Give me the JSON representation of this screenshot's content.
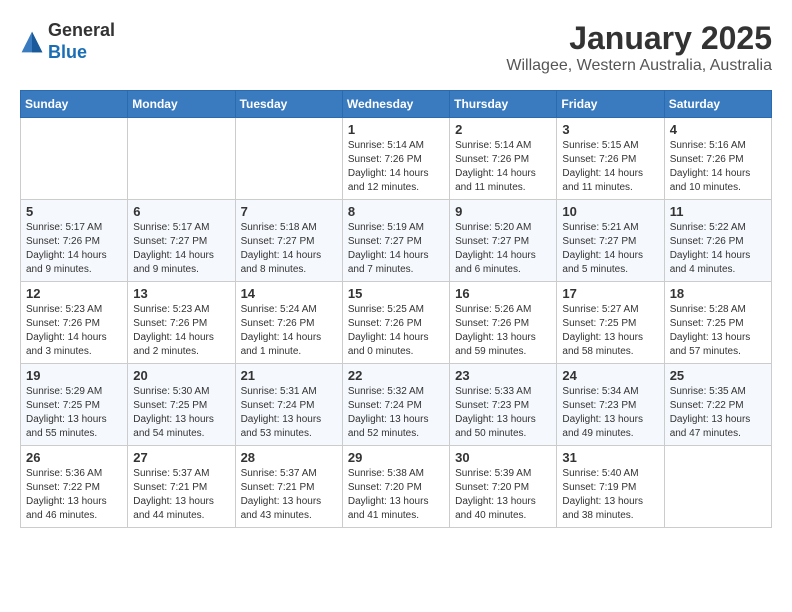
{
  "header": {
    "logo_general": "General",
    "logo_blue": "Blue",
    "title": "January 2025",
    "subtitle": "Willagee, Western Australia, Australia"
  },
  "weekdays": [
    "Sunday",
    "Monday",
    "Tuesday",
    "Wednesday",
    "Thursday",
    "Friday",
    "Saturday"
  ],
  "weeks": [
    [
      {
        "day": "",
        "info": ""
      },
      {
        "day": "",
        "info": ""
      },
      {
        "day": "",
        "info": ""
      },
      {
        "day": "1",
        "info": "Sunrise: 5:14 AM\nSunset: 7:26 PM\nDaylight: 14 hours and 12 minutes."
      },
      {
        "day": "2",
        "info": "Sunrise: 5:14 AM\nSunset: 7:26 PM\nDaylight: 14 hours and 11 minutes."
      },
      {
        "day": "3",
        "info": "Sunrise: 5:15 AM\nSunset: 7:26 PM\nDaylight: 14 hours and 11 minutes."
      },
      {
        "day": "4",
        "info": "Sunrise: 5:16 AM\nSunset: 7:26 PM\nDaylight: 14 hours and 10 minutes."
      }
    ],
    [
      {
        "day": "5",
        "info": "Sunrise: 5:17 AM\nSunset: 7:26 PM\nDaylight: 14 hours and 9 minutes."
      },
      {
        "day": "6",
        "info": "Sunrise: 5:17 AM\nSunset: 7:27 PM\nDaylight: 14 hours and 9 minutes."
      },
      {
        "day": "7",
        "info": "Sunrise: 5:18 AM\nSunset: 7:27 PM\nDaylight: 14 hours and 8 minutes."
      },
      {
        "day": "8",
        "info": "Sunrise: 5:19 AM\nSunset: 7:27 PM\nDaylight: 14 hours and 7 minutes."
      },
      {
        "day": "9",
        "info": "Sunrise: 5:20 AM\nSunset: 7:27 PM\nDaylight: 14 hours and 6 minutes."
      },
      {
        "day": "10",
        "info": "Sunrise: 5:21 AM\nSunset: 7:27 PM\nDaylight: 14 hours and 5 minutes."
      },
      {
        "day": "11",
        "info": "Sunrise: 5:22 AM\nSunset: 7:26 PM\nDaylight: 14 hours and 4 minutes."
      }
    ],
    [
      {
        "day": "12",
        "info": "Sunrise: 5:23 AM\nSunset: 7:26 PM\nDaylight: 14 hours and 3 minutes."
      },
      {
        "day": "13",
        "info": "Sunrise: 5:23 AM\nSunset: 7:26 PM\nDaylight: 14 hours and 2 minutes."
      },
      {
        "day": "14",
        "info": "Sunrise: 5:24 AM\nSunset: 7:26 PM\nDaylight: 14 hours and 1 minute."
      },
      {
        "day": "15",
        "info": "Sunrise: 5:25 AM\nSunset: 7:26 PM\nDaylight: 14 hours and 0 minutes."
      },
      {
        "day": "16",
        "info": "Sunrise: 5:26 AM\nSunset: 7:26 PM\nDaylight: 13 hours and 59 minutes."
      },
      {
        "day": "17",
        "info": "Sunrise: 5:27 AM\nSunset: 7:25 PM\nDaylight: 13 hours and 58 minutes."
      },
      {
        "day": "18",
        "info": "Sunrise: 5:28 AM\nSunset: 7:25 PM\nDaylight: 13 hours and 57 minutes."
      }
    ],
    [
      {
        "day": "19",
        "info": "Sunrise: 5:29 AM\nSunset: 7:25 PM\nDaylight: 13 hours and 55 minutes."
      },
      {
        "day": "20",
        "info": "Sunrise: 5:30 AM\nSunset: 7:25 PM\nDaylight: 13 hours and 54 minutes."
      },
      {
        "day": "21",
        "info": "Sunrise: 5:31 AM\nSunset: 7:24 PM\nDaylight: 13 hours and 53 minutes."
      },
      {
        "day": "22",
        "info": "Sunrise: 5:32 AM\nSunset: 7:24 PM\nDaylight: 13 hours and 52 minutes."
      },
      {
        "day": "23",
        "info": "Sunrise: 5:33 AM\nSunset: 7:23 PM\nDaylight: 13 hours and 50 minutes."
      },
      {
        "day": "24",
        "info": "Sunrise: 5:34 AM\nSunset: 7:23 PM\nDaylight: 13 hours and 49 minutes."
      },
      {
        "day": "25",
        "info": "Sunrise: 5:35 AM\nSunset: 7:22 PM\nDaylight: 13 hours and 47 minutes."
      }
    ],
    [
      {
        "day": "26",
        "info": "Sunrise: 5:36 AM\nSunset: 7:22 PM\nDaylight: 13 hours and 46 minutes."
      },
      {
        "day": "27",
        "info": "Sunrise: 5:37 AM\nSunset: 7:21 PM\nDaylight: 13 hours and 44 minutes."
      },
      {
        "day": "28",
        "info": "Sunrise: 5:37 AM\nSunset: 7:21 PM\nDaylight: 13 hours and 43 minutes."
      },
      {
        "day": "29",
        "info": "Sunrise: 5:38 AM\nSunset: 7:20 PM\nDaylight: 13 hours and 41 minutes."
      },
      {
        "day": "30",
        "info": "Sunrise: 5:39 AM\nSunset: 7:20 PM\nDaylight: 13 hours and 40 minutes."
      },
      {
        "day": "31",
        "info": "Sunrise: 5:40 AM\nSunset: 7:19 PM\nDaylight: 13 hours and 38 minutes."
      },
      {
        "day": "",
        "info": ""
      }
    ]
  ]
}
